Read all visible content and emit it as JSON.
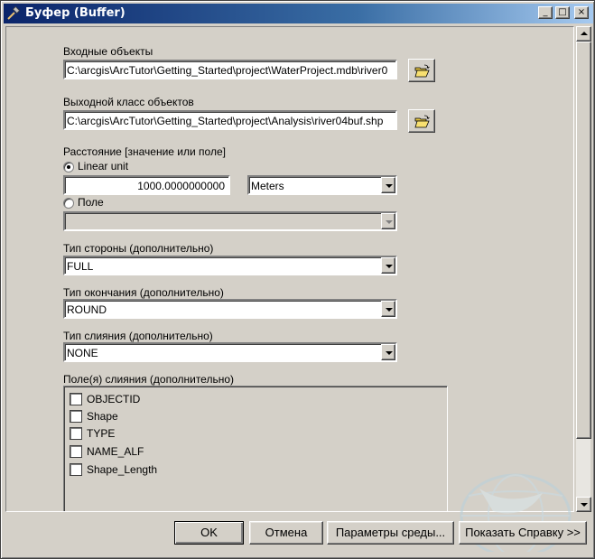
{
  "window": {
    "title": "Буфер (Buffer)",
    "minimize_glyph": "_",
    "maximize_glyph": "□",
    "close_glyph": "×"
  },
  "input_features": {
    "label": "Входные объекты",
    "value": "C:\\arcgis\\ArcTutor\\Getting_Started\\project\\WaterProject.mdb\\river0",
    "browse_icon": "open-folder-icon"
  },
  "output_feature_class": {
    "label": "Выходной класс объектов",
    "value": "C:\\arcgis\\ArcTutor\\Getting_Started\\project\\Analysis\\river04buf.shp",
    "browse_icon": "open-folder-icon"
  },
  "distance": {
    "label": "Расстояние [значение или поле]",
    "linear_unit_label": "Linear unit",
    "linear_unit_selected": true,
    "value": "1000.0000000000",
    "unit": "Meters",
    "field_label": "Поле",
    "field_selected": false,
    "field_value": ""
  },
  "side_type": {
    "label": "Тип стороны (дополнительно)",
    "value": "FULL"
  },
  "end_type": {
    "label": "Тип окончания (дополнительно)",
    "value": "ROUND"
  },
  "dissolve_type": {
    "label": "Тип слияния (дополнительно)",
    "value": "NONE"
  },
  "dissolve_fields": {
    "label": "Поле(я) слияния (дополнительно)",
    "items": [
      {
        "label": "OBJECTID",
        "checked": false
      },
      {
        "label": "Shape",
        "checked": false
      },
      {
        "label": "TYPE",
        "checked": false
      },
      {
        "label": "NAME_ALF",
        "checked": false
      },
      {
        "label": "Shape_Length",
        "checked": false
      }
    ]
  },
  "buttons": {
    "ok": "OK",
    "cancel": "Отмена",
    "environments": "Параметры среды...",
    "show_help": "Показать Справку >>"
  }
}
